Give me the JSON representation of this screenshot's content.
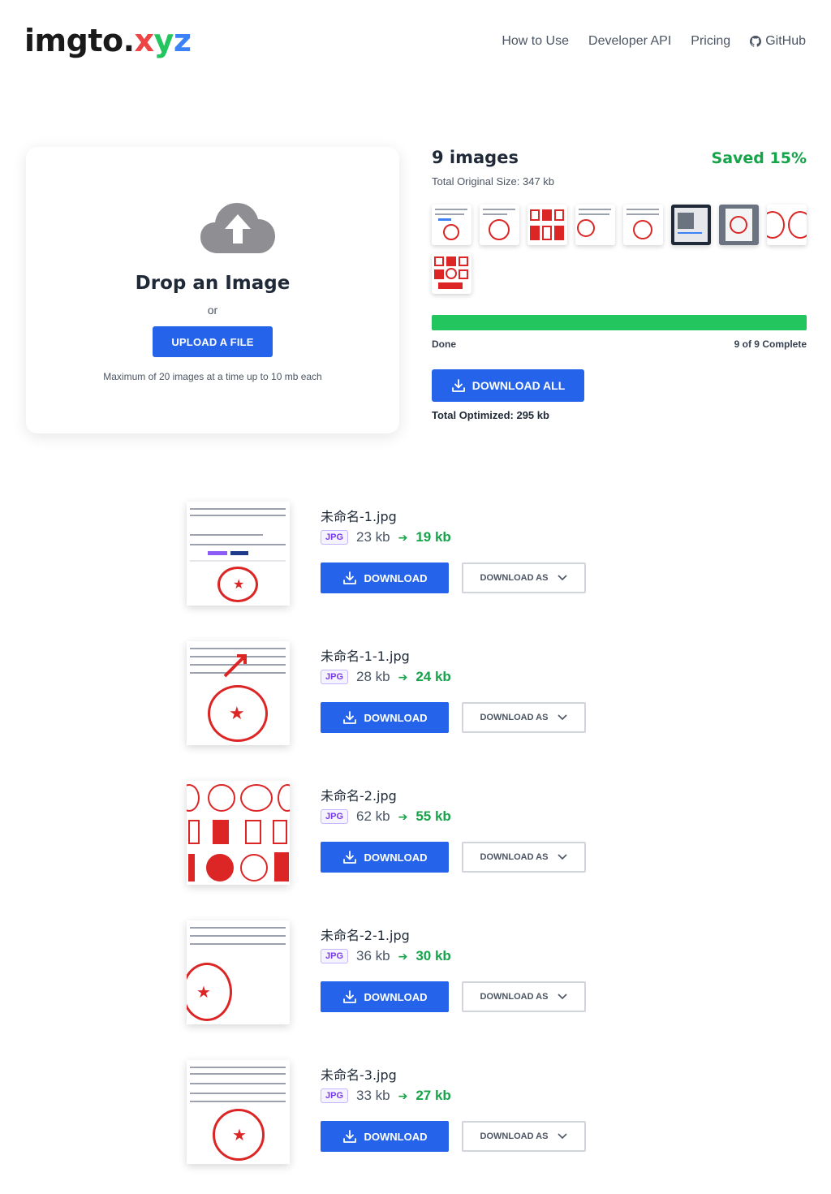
{
  "header": {
    "logo_main": "imgto.",
    "logo_x": "x",
    "logo_y": "y",
    "logo_z": "z",
    "nav": [
      "How to Use",
      "Developer API",
      "Pricing",
      "GitHub"
    ]
  },
  "upload": {
    "title": "Drop an Image",
    "or": "or",
    "button": "UPLOAD A FILE",
    "limit": "Maximum of 20 images at a time up to 10 mb each"
  },
  "summary": {
    "count": "9 images",
    "saved": "Saved 15%",
    "original_size": "Total Original Size: 347 kb",
    "progress_fraction": 1.0,
    "status_left": "Done",
    "status_right": "9 of 9 Complete",
    "download_all": "DOWNLOAD ALL",
    "total_optimized": "Total Optimized: 295 kb",
    "thumbnail_count": 9
  },
  "files": [
    {
      "name": "未命名-1.jpg",
      "type": "JPG",
      "original": "23 kb",
      "optimized": "19 kb"
    },
    {
      "name": "未命名-1-1.jpg",
      "type": "JPG",
      "original": "28 kb",
      "optimized": "24 kb"
    },
    {
      "name": "未命名-2.jpg",
      "type": "JPG",
      "original": "62 kb",
      "optimized": "55 kb"
    },
    {
      "name": "未命名-2-1.jpg",
      "type": "JPG",
      "original": "36 kb",
      "optimized": "30 kb"
    },
    {
      "name": "未命名-3.jpg",
      "type": "JPG",
      "original": "33 kb",
      "optimized": "27 kb"
    }
  ],
  "buttons": {
    "download": "DOWNLOAD",
    "download_as": "DOWNLOAD AS"
  },
  "colors": {
    "primary": "#2563eb",
    "success": "#16a34a",
    "progress": "#22c55e",
    "stamp_red": "#dc2626"
  }
}
